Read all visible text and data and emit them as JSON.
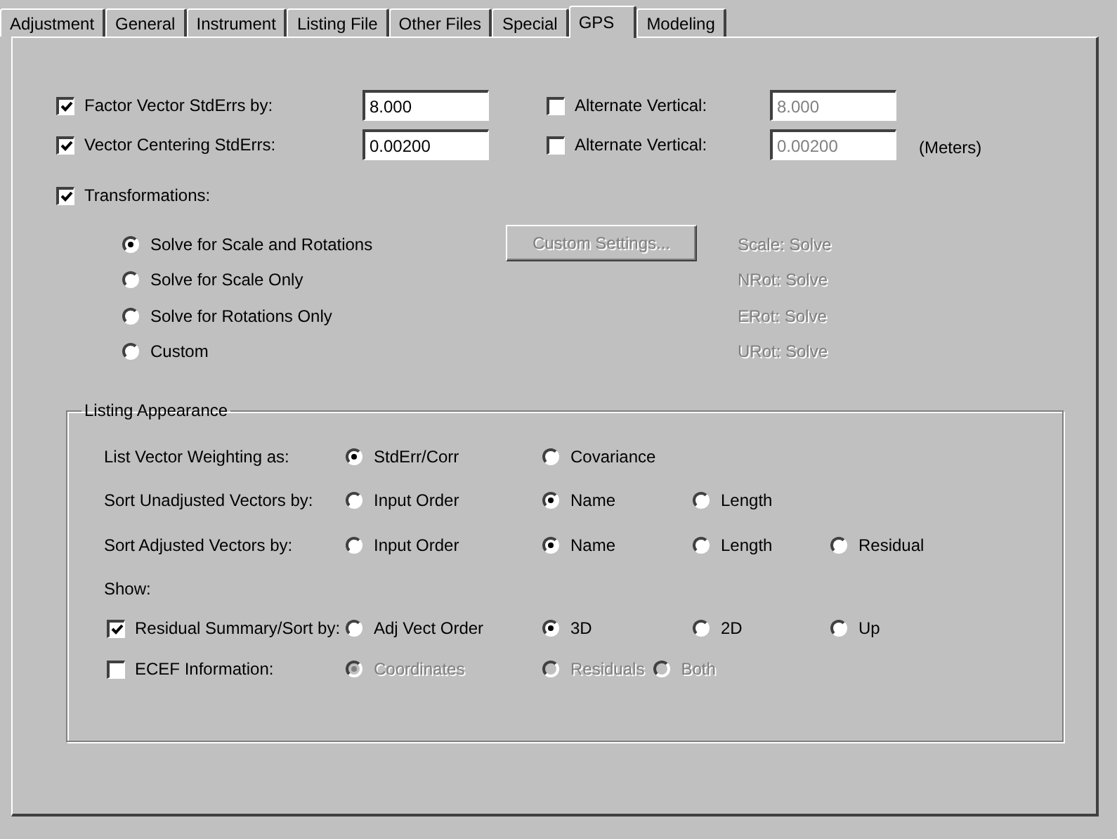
{
  "tabs": [
    {
      "label": "Adjustment",
      "selected": false
    },
    {
      "label": "General",
      "selected": false
    },
    {
      "label": "Instrument",
      "selected": false
    },
    {
      "label": "Listing File",
      "selected": false
    },
    {
      "label": "Other Files",
      "selected": false
    },
    {
      "label": "Special",
      "selected": false
    },
    {
      "label": "GPS",
      "selected": true
    },
    {
      "label": "Modeling",
      "selected": false
    }
  ],
  "factor_rows": [
    {
      "label": "Factor Vector StdErrs by:",
      "checked": true,
      "value": "8.000",
      "alt_label": "Alternate Vertical:",
      "alt_checked": false,
      "alt_value": "8.000"
    },
    {
      "label": "Vector Centering StdErrs:",
      "checked": true,
      "value": "0.00200",
      "alt_label": "Alternate Vertical:",
      "alt_checked": false,
      "alt_value": "0.00200",
      "unit": "(Meters)"
    }
  ],
  "transformations": {
    "label": "Transformations:",
    "checked": true,
    "options": [
      {
        "label": "Solve for Scale and Rotations",
        "selected": true
      },
      {
        "label": "Solve for Scale Only",
        "selected": false
      },
      {
        "label": "Solve for Rotations Only",
        "selected": false
      },
      {
        "label": "Custom",
        "selected": false
      }
    ],
    "button": {
      "label": "Custom Settings...",
      "disabled": true
    },
    "status": [
      "Scale: Solve",
      "NRot: Solve",
      "ERot: Solve",
      "URot: Solve"
    ]
  },
  "listing": {
    "title": "Listing Appearance",
    "rows": [
      {
        "kind": "radios",
        "label": "List Vector Weighting as:",
        "options": [
          {
            "label": "StdErr/Corr",
            "selected": true
          },
          {
            "label": "Covariance",
            "selected": false
          }
        ]
      },
      {
        "kind": "radios",
        "label": "Sort Unadjusted Vectors by:",
        "options": [
          {
            "label": "Input Order",
            "selected": false
          },
          {
            "label": "Name",
            "selected": true
          },
          {
            "label": "Length",
            "selected": false
          }
        ]
      },
      {
        "kind": "radios",
        "label": "Sort Adjusted Vectors by:",
        "options": [
          {
            "label": "Input Order",
            "selected": false
          },
          {
            "label": "Name",
            "selected": true
          },
          {
            "label": "Length",
            "selected": false
          },
          {
            "label": "Residual",
            "selected": false
          }
        ]
      },
      {
        "kind": "heading",
        "label": "Show:"
      },
      {
        "kind": "checkbox",
        "label": "Residual Summary/Sort by:",
        "checked": true,
        "disabled": false,
        "options": [
          {
            "label": "Adj Vect Order",
            "selected": false
          },
          {
            "label": "3D",
            "selected": true
          },
          {
            "label": "2D",
            "selected": false
          },
          {
            "label": "Up",
            "selected": false
          }
        ]
      },
      {
        "kind": "checkbox",
        "label": "ECEF Information:",
        "checked": false,
        "disabled": true,
        "options": [
          {
            "label": "Coordinates",
            "selected": true
          },
          {
            "label": "Residuals",
            "selected": false
          },
          {
            "label": "Both",
            "selected": false
          }
        ]
      }
    ]
  }
}
